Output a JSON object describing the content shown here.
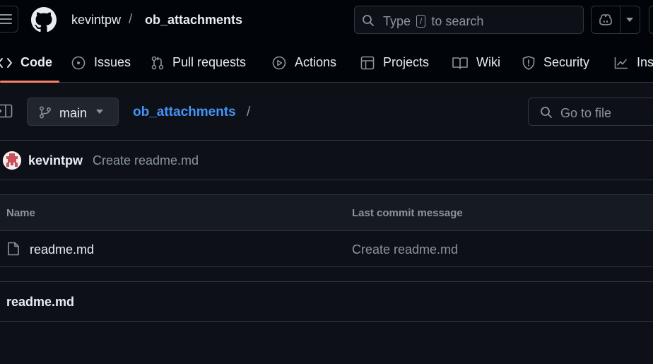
{
  "header": {
    "owner": "kevintpw",
    "separator": "/",
    "repo": "ob_attachments",
    "search": {
      "prefix": "Type",
      "key": "/",
      "suffix": "to search"
    }
  },
  "tabs": [
    {
      "label": "Code",
      "icon": "code-icon",
      "active": true
    },
    {
      "label": "Issues",
      "icon": "issue-opened-icon"
    },
    {
      "label": "Pull requests",
      "icon": "git-pull-request-icon"
    },
    {
      "label": "Actions",
      "icon": "play-icon"
    },
    {
      "label": "Projects",
      "icon": "table-icon"
    },
    {
      "label": "Wiki",
      "icon": "book-icon"
    },
    {
      "label": "Security",
      "icon": "shield-icon"
    },
    {
      "label": "Ins",
      "icon": "graph-icon"
    }
  ],
  "branch": {
    "name": "main"
  },
  "breadcrumb": {
    "repo": "ob_attachments",
    "separator": "/"
  },
  "go_to_file": {
    "placeholder": "Go to file"
  },
  "latest_commit": {
    "author": "kevintpw",
    "message": "Create readme.md"
  },
  "file_table": {
    "columns": [
      "Name",
      "Last commit message"
    ],
    "rows": [
      {
        "name": "readme.md",
        "commit_message": "Create readme.md",
        "icon": "file-icon"
      }
    ]
  },
  "readme": {
    "title": "readme.md"
  },
  "colors": {
    "background": "#0d1117",
    "header_background": "#010409",
    "border": "#30363d",
    "link": "#4493f8",
    "muted_text": "#8b949e",
    "active_tab_underline": "#f78166"
  }
}
